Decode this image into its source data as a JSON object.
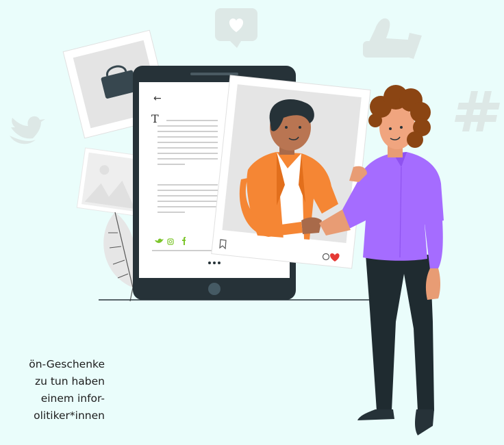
{
  "caption": {
    "lines": [
      "ön-Geschenke",
      " zu tun haben",
      " einem infor-",
      "olitiker*innen"
    ]
  },
  "tablet": {
    "back_arrow": "←",
    "title_letter": "T"
  },
  "colors": {
    "background": "#eafdfb",
    "tablet_frame": "#263238",
    "jacket": "#f58634",
    "shirt_purple": "#a56cff",
    "like_heart": "#e53935",
    "social_green": "#7cc52b",
    "decor_icon": "#dde8e6"
  },
  "icons": [
    "twitter-icon",
    "heart-bubble-icon",
    "thumbs-up-icon",
    "hashtag-icon",
    "bookmark-icon",
    "comment-icon",
    "instagram-icon",
    "facebook-icon"
  ]
}
